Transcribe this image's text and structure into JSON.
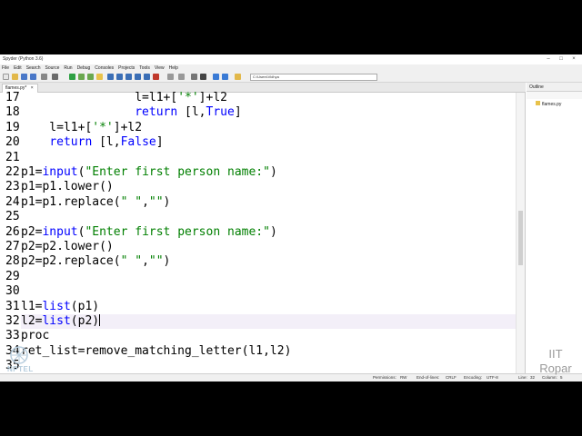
{
  "window_title": "Spyder (Python 3.6)",
  "menu": [
    "File",
    "Edit",
    "Search",
    "Source",
    "Run",
    "Debug",
    "Consoles",
    "Projects",
    "Tools",
    "View",
    "Help"
  ],
  "toolbar": {
    "path": "C:\\Users\\Vidhya"
  },
  "tab": {
    "label": "flames.py*",
    "close": "×"
  },
  "outline": {
    "title": "Outline",
    "item": "flames.py"
  },
  "code": {
    "lines": [
      {
        "num": "17",
        "text": "                l=l1+['*']+l2"
      },
      {
        "num": "18",
        "text": "                return [l,True]"
      },
      {
        "num": "19",
        "text": "    l=l1+['*']+l2"
      },
      {
        "num": "20",
        "text": "    return [l,False]"
      },
      {
        "num": "21",
        "text": ""
      },
      {
        "num": "22",
        "text": "p1=input(\"Enter first person name:\")"
      },
      {
        "num": "23",
        "text": "p1=p1.lower()"
      },
      {
        "num": "24",
        "text": "p1=p1.replace(\" \",\"\")"
      },
      {
        "num": "25",
        "text": ""
      },
      {
        "num": "26",
        "text": "p2=input(\"Enter first person name:\")"
      },
      {
        "num": "27",
        "text": "p2=p2.lower()"
      },
      {
        "num": "28",
        "text": "p2=p2.replace(\" \",\"\")"
      },
      {
        "num": "29",
        "text": ""
      },
      {
        "num": "30",
        "text": ""
      },
      {
        "num": "31",
        "text": "l1=list(p1)"
      },
      {
        "num": "32",
        "text": "l2=list(p2)"
      },
      {
        "num": "33",
        "text": "proc"
      },
      {
        "num": "34",
        "text": "ret_list=remove_matching_letter(l1,l2)"
      },
      {
        "num": "35",
        "text": ""
      }
    ]
  },
  "status": {
    "permissions_label": "Permissions:",
    "permissions": "RW",
    "eol_label": "End-of-lines:",
    "eol": "CRLF",
    "encoding_label": "Encoding:",
    "encoding": "UTF-8",
    "line_label": "Line:",
    "line": "32",
    "column_label": "Column:",
    "column": "5"
  },
  "watermark": {
    "nptel": "NPTEL",
    "institute_line1": "IIT",
    "institute_line2": "Ropar"
  },
  "colors": {
    "keyword": "#0000ff",
    "string": "#007f00",
    "current_line": "#f3eff8"
  }
}
